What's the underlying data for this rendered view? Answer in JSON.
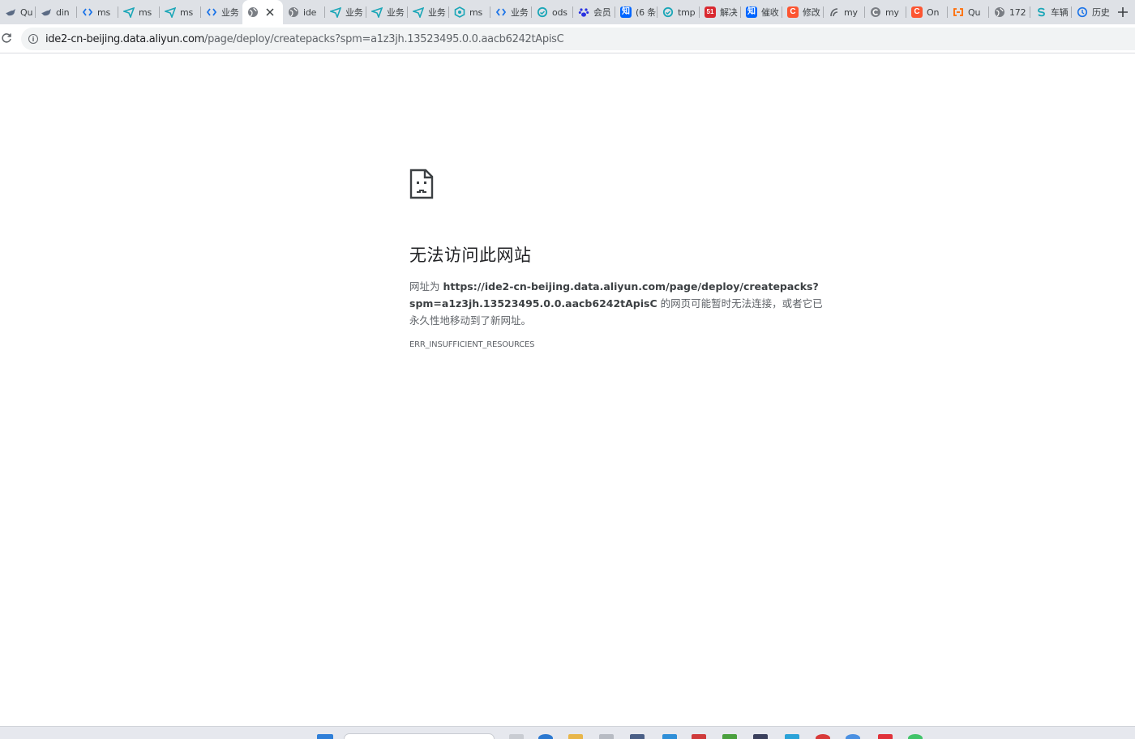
{
  "tabs": [
    {
      "title": "Qu",
      "favicon": "bird-icon",
      "color": "#5b6b84"
    },
    {
      "title": "din",
      "favicon": "bird-icon",
      "color": "#5b6b84"
    },
    {
      "title": "ms",
      "favicon": "code-bracket-icon",
      "color": "#1a73e8"
    },
    {
      "title": "ms",
      "favicon": "send-icon",
      "color": "#1aa6b7"
    },
    {
      "title": "ms",
      "favicon": "send-icon",
      "color": "#1aa6b7"
    },
    {
      "title": "业务",
      "favicon": "code-bracket-icon",
      "color": "#1a73e8"
    },
    {
      "title": "",
      "favicon": "globe-icon",
      "color": "#5f6368",
      "active": true
    },
    {
      "title": "ide",
      "favicon": "globe-icon",
      "color": "#5f6368"
    },
    {
      "title": "业务",
      "favicon": "send-icon",
      "color": "#1aa6b7"
    },
    {
      "title": "业务",
      "favicon": "send-icon",
      "color": "#1aa6b7"
    },
    {
      "title": "业务",
      "favicon": "send-icon",
      "color": "#1aa6b7"
    },
    {
      "title": "ms",
      "favicon": "hexagon-icon",
      "color": "#1aa6b7"
    },
    {
      "title": "业务",
      "favicon": "code-bracket-icon",
      "color": "#1a73e8"
    },
    {
      "title": "ods",
      "favicon": "ring-icon",
      "color": "#1aa6b7"
    },
    {
      "title": "会员",
      "favicon": "paw-icon",
      "color": "#2932e1"
    },
    {
      "title": "(6 条",
      "favicon": "zhihu-icon",
      "color": "#0066ff",
      "glyph": "知"
    },
    {
      "title": "tmp",
      "favicon": "ring-icon",
      "color": "#1aa6b7"
    },
    {
      "title": "解决",
      "favicon": "cto51-icon",
      "color": "#d9282f",
      "glyph": "51"
    },
    {
      "title": "催收",
      "favicon": "zhihu-icon",
      "color": "#0066ff",
      "glyph": "知"
    },
    {
      "title": "修改",
      "favicon": "csdn-icon",
      "color": "#fc5531",
      "glyph": "C"
    },
    {
      "title": "my",
      "favicon": "swirl-icon",
      "color": "#5f6368"
    },
    {
      "title": "my",
      "favicon": "c-logo-icon",
      "color": "#5f6368"
    },
    {
      "title": "On",
      "favicon": "csdn-icon",
      "color": "#fc5531",
      "glyph": "C"
    },
    {
      "title": "Qu",
      "favicon": "aliyun-icon",
      "color": "#ff6a00"
    },
    {
      "title": "172",
      "favicon": "globe-icon",
      "color": "#5f6368"
    },
    {
      "title": "车辆",
      "favicon": "s-logo-icon",
      "color": "#1aa6b7"
    },
    {
      "title": "历史",
      "favicon": "history-icon",
      "color": "#1a73e8"
    }
  ],
  "toolbar": {
    "url_host": "ide2-cn-beijing.data.aliyun.com",
    "url_path": "/page/deploy/createpacks?spm=a1z3jh.13523495.0.0.aacb6242tApisC"
  },
  "error": {
    "heading": "无法访问此网站",
    "desc_prefix": "网址为 ",
    "desc_url_line1": "https://ide2-cn-beijing.data.aliyun.com/page/deploy/createpacks?",
    "desc_url_line2": "spm=a1z3jh.13523495.0.0.aacb6242tApisC",
    "desc_suffix": " 的网页可能暂时无法连接，或者它已永久性地移动到了新网址。",
    "code": "ERR_INSUFFICIENT_RESOURCES"
  }
}
